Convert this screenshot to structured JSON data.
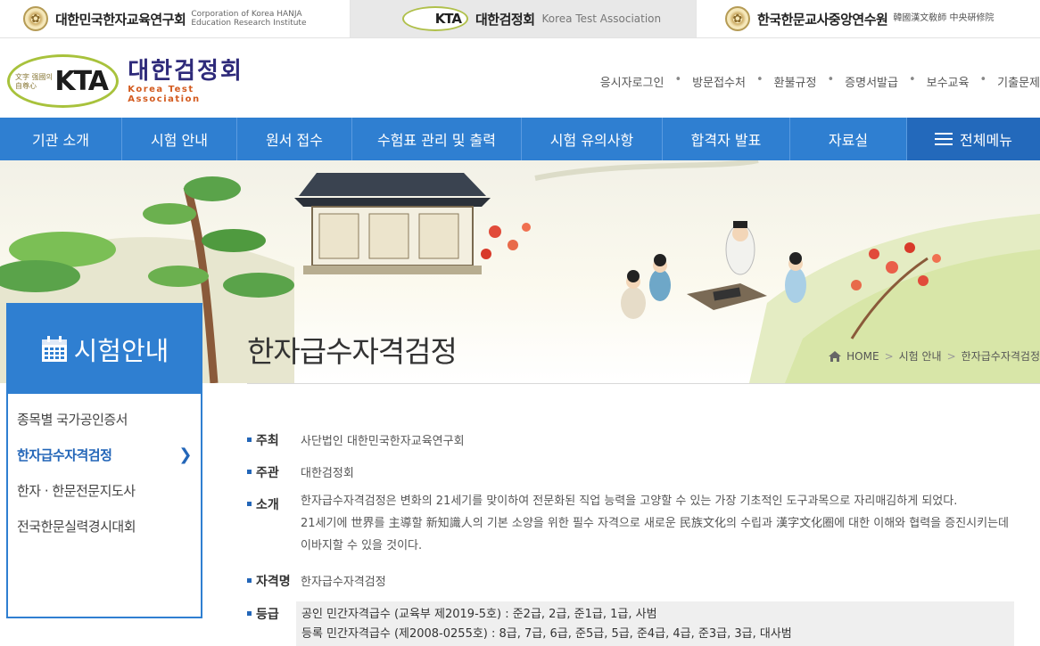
{
  "family_bar": {
    "site1": {
      "name": "대한민국한자교육연구회",
      "sub": "Corporation of Korea HANJA Education Research Institute"
    },
    "site2": {
      "logo": "KTA",
      "name": "대한검정회",
      "sub": "Korea Test Association"
    },
    "site3": {
      "name": "한국한문교사중앙연수원",
      "sub": "韓國漢文敎師 中央硏修院"
    }
  },
  "header": {
    "logo_text": "KTA",
    "logo_small": "文字 强國의 自尊心",
    "logo_kor": "대한검정회",
    "logo_eng": "Korea Test Association",
    "util_links": [
      "응시자로그인",
      "방문접수처",
      "환불규정",
      "증명서발급",
      "보수교육",
      "기출문제"
    ]
  },
  "nav": {
    "items": [
      "기관 소개",
      "시험 안내",
      "원서 접수",
      "수험표 관리 및 출력",
      "시험 유의사항",
      "합격자 발표",
      "자료실"
    ],
    "all_menu": "전체메뉴"
  },
  "sidebar": {
    "title": "시험안내",
    "items": [
      {
        "label": "종목별 국가공인증서",
        "active": false
      },
      {
        "label": "한자급수자격검정",
        "active": true
      },
      {
        "label": "한자 · 한문전문지도사",
        "active": false
      },
      {
        "label": "전국한문실력경시대회",
        "active": false
      }
    ]
  },
  "content": {
    "title": "한자급수자격검정",
    "breadcrumb": [
      "HOME",
      "시험 안내",
      "한자급수자격검정"
    ],
    "fields": {
      "host_label": "주최",
      "host_value": "사단법인 대한민국한자교육연구회",
      "org_label": "주관",
      "org_value": "대한검정회",
      "intro_label": "소개",
      "intro_lines": [
        "한자급수자격검정은 변화의 21세기를 맞이하여 전문화된 직업 능력을 고양할 수 있는 가장 기초적인 도구과목으로 자리매김하게 되었다.",
        "21세기에 世界를 主導할 新知識人의 기본 소양을 위한 필수 자격으로 새로운 民族文化의 수립과 漢字文化圈에 대한 이해와 협력을 증진시키는데",
        "이바지할 수 있을 것이다."
      ],
      "name_label": "자격명",
      "name_value": "한자급수자격검정",
      "grade_label": "등급",
      "grade_lines": [
        "공인 민간자격급수 (교육부 제2019-5호) : 준2급, 2급, 준1급, 1급, 사범",
        "등록 민간자격급수 (제2008-0255호) : 8급, 7급, 6급, 준5급, 5급, 준4급, 4급, 준3급, 3급, 대사범"
      ]
    }
  },
  "colors": {
    "primary": "#2f7fd1",
    "active_text": "#2366b8"
  }
}
